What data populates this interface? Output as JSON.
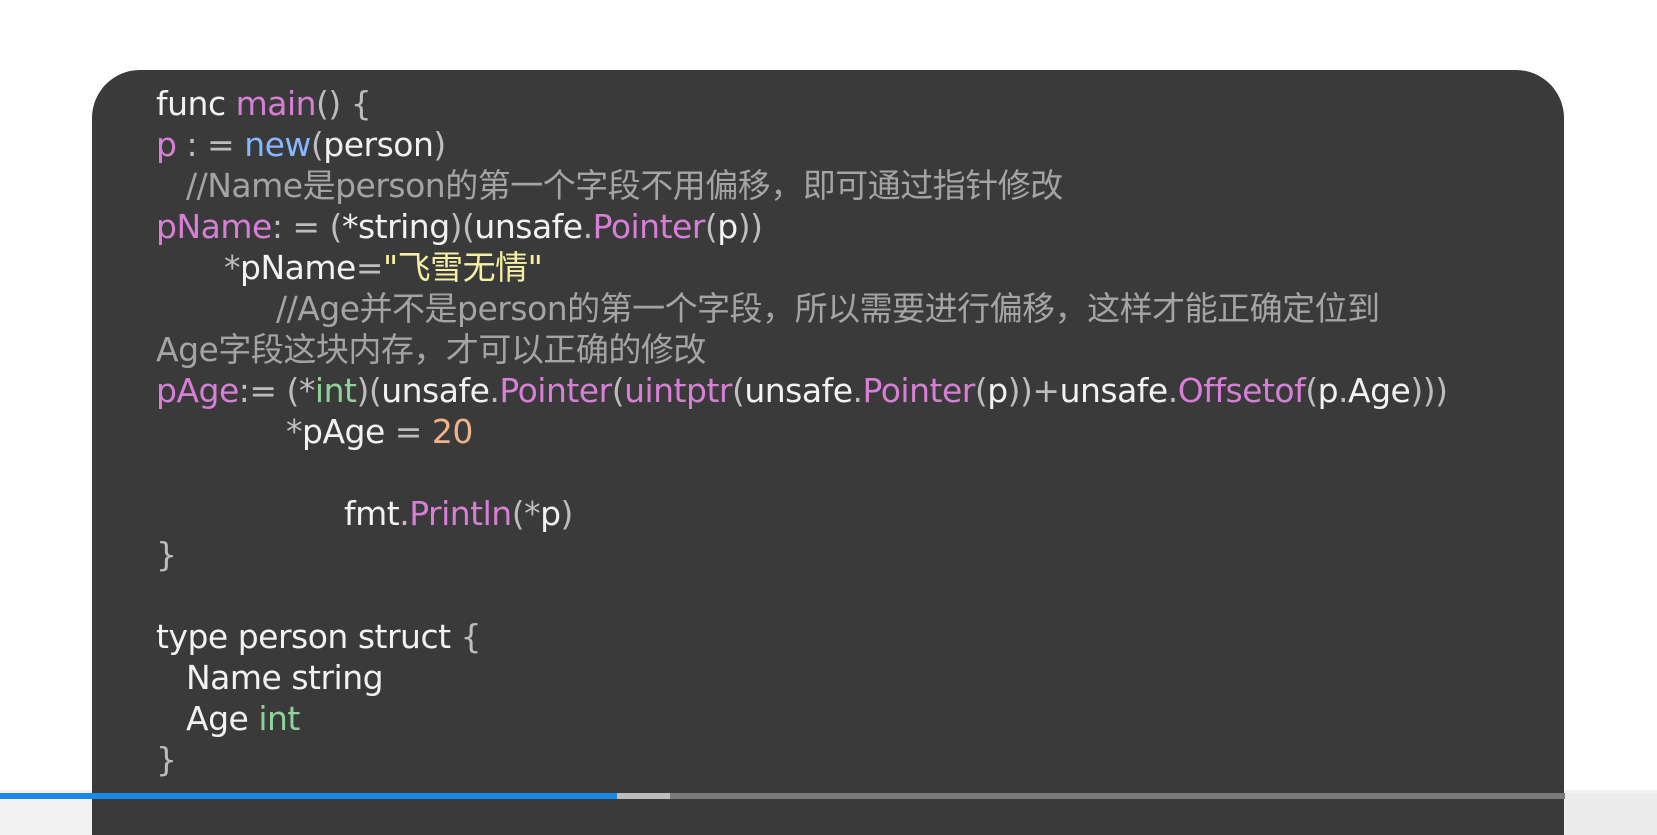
{
  "code": {
    "lines": [
      {
        "indent": 0,
        "tokens": [
          {
            "t": "func ",
            "c": "kw"
          },
          {
            "t": "main",
            "c": "fn"
          },
          {
            "t": "() {",
            "c": "punc"
          }
        ]
      },
      {
        "indent": 0,
        "tokens": [
          {
            "t": "p",
            "c": "var"
          },
          {
            "t": " : = ",
            "c": "punc"
          },
          {
            "t": "new",
            "c": "blue"
          },
          {
            "t": "(",
            "c": "punc"
          },
          {
            "t": "person",
            "c": "kw"
          },
          {
            "t": ")",
            "c": "punc"
          }
        ]
      },
      {
        "indent": 1,
        "tokens": [
          {
            "t": "//Name是person的第一个字段不用偏移，即可通过指针修改",
            "c": "comment"
          }
        ]
      },
      {
        "indent": 0,
        "tokens": [
          {
            "t": "pName",
            "c": "var"
          },
          {
            "t": ": = (",
            "c": "punc"
          },
          {
            "t": "*string",
            "c": "kw"
          },
          {
            "t": ")(",
            "c": "punc"
          },
          {
            "t": "unsafe",
            "c": "kw"
          },
          {
            "t": ".",
            "c": "punc"
          },
          {
            "t": "Pointer",
            "c": "fn"
          },
          {
            "t": "(",
            "c": "punc"
          },
          {
            "t": "p",
            "c": "kw"
          },
          {
            "t": "))",
            "c": "punc"
          }
        ]
      },
      {
        "indent": 2,
        "tokens": [
          {
            "t": "*",
            "c": "punc"
          },
          {
            "t": "pName",
            "c": "kw"
          },
          {
            "t": "=",
            "c": "punc"
          },
          {
            "t": "\"飞雪无情\"",
            "c": "str"
          }
        ]
      },
      {
        "indent": 3,
        "tokens": [
          {
            "t": "//Age并不是person的第一个字段，所以需要进行偏移，这样才能正确定位到",
            "c": "comment"
          }
        ]
      },
      {
        "indent": 0,
        "tokens": [
          {
            "t": "Age字段这块内存，才可以正确的修改",
            "c": "comment"
          }
        ]
      },
      {
        "indent": 0,
        "tokens": [
          {
            "t": "pAge",
            "c": "var"
          },
          {
            "t": ":= (",
            "c": "punc"
          },
          {
            "t": "*",
            "c": "punc"
          },
          {
            "t": "int",
            "c": "green"
          },
          {
            "t": ")(",
            "c": "punc"
          },
          {
            "t": "unsafe",
            "c": "kw"
          },
          {
            "t": ".",
            "c": "punc"
          },
          {
            "t": "Pointer",
            "c": "fn"
          },
          {
            "t": "(",
            "c": "punc"
          },
          {
            "t": "uintptr",
            "c": "fn"
          },
          {
            "t": "(",
            "c": "punc"
          },
          {
            "t": "unsafe",
            "c": "kw"
          },
          {
            "t": ".",
            "c": "punc"
          },
          {
            "t": "Pointer",
            "c": "fn"
          },
          {
            "t": "(",
            "c": "punc"
          },
          {
            "t": "p",
            "c": "kw"
          },
          {
            "t": "))+",
            "c": "punc"
          },
          {
            "t": "unsafe",
            "c": "kw"
          },
          {
            "t": ".",
            "c": "punc"
          },
          {
            "t": "Offsetof",
            "c": "fn"
          },
          {
            "t": "(",
            "c": "punc"
          },
          {
            "t": "p",
            "c": "kw"
          },
          {
            "t": ".",
            "c": "punc"
          },
          {
            "t": "Age",
            "c": "kw"
          },
          {
            "t": ")))",
            "c": "punc"
          }
        ]
      },
      {
        "indent": 4,
        "tokens": [
          {
            "t": "*",
            "c": "punc"
          },
          {
            "t": "pAge",
            "c": "kw"
          },
          {
            "t": " = ",
            "c": "punc"
          },
          {
            "t": "20",
            "c": "num"
          }
        ]
      },
      {
        "indent": 0,
        "tokens": []
      },
      {
        "indent": 5,
        "tokens": [
          {
            "t": "fmt",
            "c": "kw"
          },
          {
            "t": ".",
            "c": "punc"
          },
          {
            "t": "Println",
            "c": "fn"
          },
          {
            "t": "(",
            "c": "punc"
          },
          {
            "t": "*",
            "c": "punc"
          },
          {
            "t": "p",
            "c": "kw"
          },
          {
            "t": ")",
            "c": "punc"
          }
        ]
      },
      {
        "indent": 0,
        "tokens": [
          {
            "t": "}",
            "c": "punc"
          }
        ]
      },
      {
        "indent": 0,
        "tokens": []
      },
      {
        "indent": 0,
        "tokens": [
          {
            "t": "type ",
            "c": "kw"
          },
          {
            "t": "person ",
            "c": "kw"
          },
          {
            "t": "struct ",
            "c": "kw"
          },
          {
            "t": "{",
            "c": "punc"
          }
        ]
      },
      {
        "indent": 1,
        "tokens": [
          {
            "t": "Name ",
            "c": "kw"
          },
          {
            "t": "string",
            "c": "kw"
          }
        ]
      },
      {
        "indent": 1,
        "tokens": [
          {
            "t": "Age ",
            "c": "kw"
          },
          {
            "t": "int",
            "c": "green"
          }
        ]
      },
      {
        "indent": 0,
        "tokens": [
          {
            "t": "}",
            "c": "punc"
          }
        ]
      }
    ]
  },
  "player": {
    "progress_played": 0.394,
    "progress_buffered": 0.428
  },
  "colors": {
    "background": "#3a3a3a",
    "accent": "#1a88e5"
  }
}
